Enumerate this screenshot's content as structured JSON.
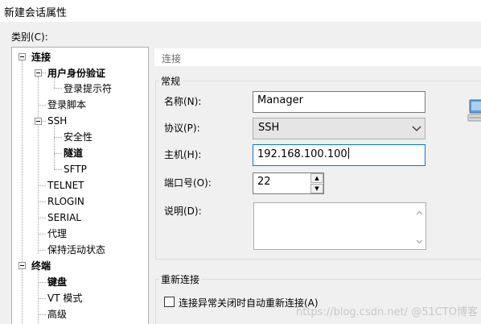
{
  "window": {
    "title": "新建会话属性"
  },
  "category": {
    "label": "类别(C):"
  },
  "tree": {
    "connection": "连接",
    "auth": "用户身份验证",
    "login_prompts": "登录提示符",
    "login_script": "登录脚本",
    "ssh": "SSH",
    "security": "安全性",
    "tunnel": "隧道",
    "sftp": "SFTP",
    "telnet": "TELNET",
    "rlogin": "RLOGIN",
    "serial": "SERIAL",
    "proxy": "代理",
    "keepalive": "保持活动状态",
    "terminal": "终端",
    "keyboard": "键盘",
    "vt_mode": "VT 模式",
    "advanced": "高级"
  },
  "panel": {
    "header": "连接",
    "general_group": "常规",
    "name_label": "名称(N):",
    "name_value": "Manager",
    "protocol_label": "协议(P):",
    "protocol_value": "SSH",
    "host_label": "主机(H):",
    "host_value": "192.168.100.100",
    "port_label": "端口号(O):",
    "port_value": "22",
    "desc_label": "说明(D):",
    "desc_value": "",
    "reconnect_group": "重新连接",
    "reconnect_checkbox": "连接异常关闭时自动重新连接(A)",
    "reconnect_checked": false
  },
  "watermark": "https://blog.csdn.net/ @51CTO博客"
}
